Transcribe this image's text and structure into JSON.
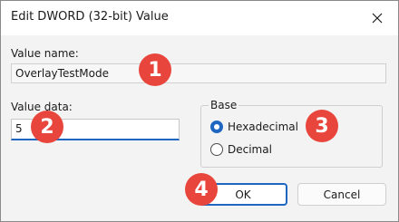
{
  "window": {
    "title": "Edit DWORD (32-bit) Value",
    "close_icon": "close-icon"
  },
  "value_name": {
    "label": "Value name:",
    "value": "OverlayTestMode"
  },
  "value_data": {
    "label": "Value data:",
    "value": "5"
  },
  "base": {
    "label": "Base",
    "options": [
      {
        "label": "Hexadecimal",
        "checked": true
      },
      {
        "label": "Decimal",
        "checked": false
      }
    ]
  },
  "buttons": {
    "ok": "OK",
    "cancel": "Cancel"
  },
  "annotations": {
    "step1": "1",
    "step2": "2",
    "step3": "3",
    "step4": "4",
    "badge_color": "#e8453c"
  }
}
